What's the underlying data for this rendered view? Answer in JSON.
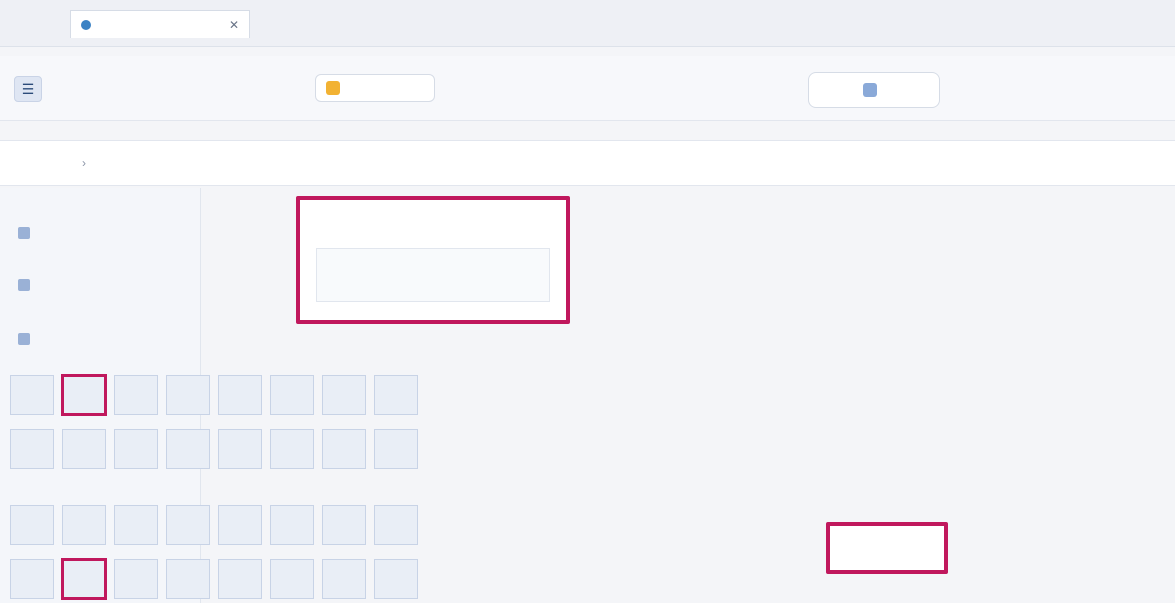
{
  "window": {
    "tab_title": "",
    "tab_icon": "dot-icon"
  },
  "toolbar": {
    "title": "",
    "chip_label": "",
    "right_chip_label": ""
  },
  "subheader": {
    "breadcrumb": [
      {
        "label": ""
      },
      {
        "label": ""
      }
    ]
  },
  "left_panel": {
    "items": [
      {
        "label": ""
      },
      {
        "label": ""
      },
      {
        "label": ""
      }
    ]
  },
  "dialog": {
    "title": "",
    "body_text": ""
  },
  "icon_grid": {
    "label": "",
    "rows": [
      {
        "cells": [
          "",
          "",
          "",
          "",
          "",
          "",
          "",
          ""
        ]
      },
      {
        "cells": [
          "",
          "",
          "",
          "",
          "",
          "",
          "",
          ""
        ]
      },
      {
        "cells": [
          "",
          "",
          "",
          "",
          "",
          "",
          "",
          ""
        ]
      },
      {
        "cells": [
          "",
          "",
          "",
          "",
          "",
          "",
          "",
          ""
        ]
      }
    ]
  },
  "actions": {
    "primary_label": ""
  },
  "colors": {
    "highlight": "#c0185d",
    "accent": "#3b82c4"
  }
}
